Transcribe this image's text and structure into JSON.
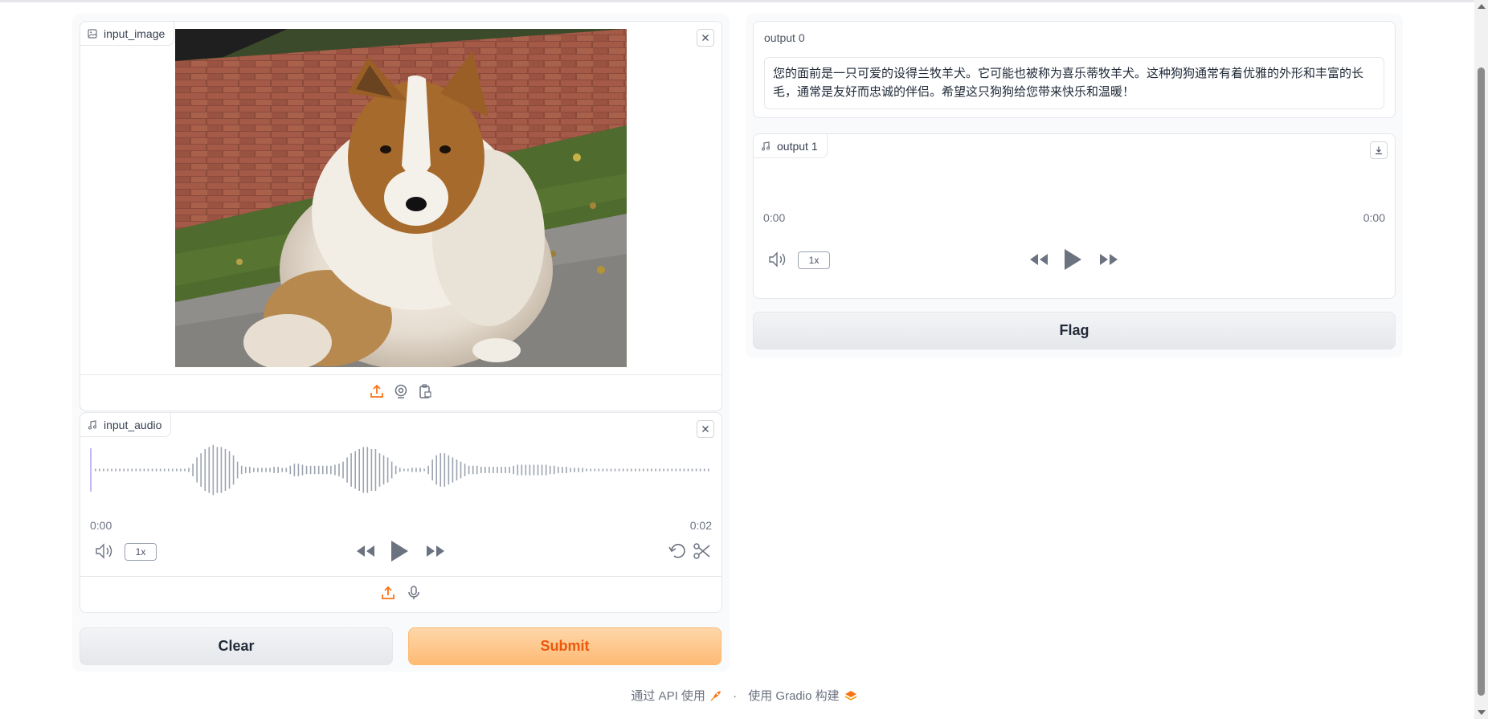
{
  "input_image": {
    "label": "input_image",
    "photo_subject": "Shetland sheepdog sitting on grass and pavement in front of a brick wall"
  },
  "input_audio": {
    "label": "input_audio",
    "time_start": "0:00",
    "time_end": "0:02",
    "speed": "1x",
    "waveform_heights": [
      1,
      1,
      1,
      1,
      1,
      1,
      1,
      1,
      1,
      1,
      1,
      1,
      1,
      1,
      1,
      1,
      1,
      1,
      1,
      1,
      1,
      1,
      1,
      2,
      6,
      12,
      16,
      20,
      22,
      24,
      22,
      22,
      20,
      18,
      14,
      8,
      4,
      3,
      3,
      2,
      2,
      2,
      2,
      2,
      3,
      3,
      2,
      2,
      4,
      6,
      6,
      5,
      4,
      4,
      4,
      4,
      4,
      4,
      4,
      5,
      6,
      8,
      12,
      16,
      18,
      20,
      22,
      22,
      20,
      20,
      16,
      14,
      12,
      8,
      4,
      2,
      1,
      1,
      2,
      2,
      2,
      1,
      4,
      10,
      14,
      16,
      16,
      14,
      12,
      10,
      8,
      6,
      4,
      4,
      4,
      3,
      3,
      3,
      3,
      3,
      3,
      3,
      3,
      4,
      5,
      5,
      5,
      5,
      5,
      5,
      5,
      5,
      4,
      4,
      3,
      3,
      3,
      2,
      2,
      2,
      2,
      1,
      1,
      1,
      1,
      1,
      1,
      1,
      1,
      1,
      1,
      1,
      1,
      1,
      1,
      1,
      1,
      1,
      1,
      1,
      1,
      1,
      1,
      1,
      1,
      1,
      1,
      1,
      1,
      1,
      1,
      1
    ]
  },
  "buttons": {
    "clear": "Clear",
    "submit": "Submit",
    "flag": "Flag"
  },
  "output0": {
    "label": "output 0",
    "text": "您的面前是一只可爱的设得兰牧羊犬。它可能也被称为喜乐蒂牧羊犬。这种狗狗通常有着优雅的外形和丰富的长毛，通常是友好而忠诚的伴侣。希望这只狗狗给您带来快乐和温暖！"
  },
  "output1": {
    "label": "output 1",
    "time_start": "0:00",
    "time_end": "0:00",
    "speed": "1x"
  },
  "footer": {
    "api": "通过 API 使用",
    "separator": "·",
    "built": "使用 Gradio 构建"
  },
  "colors": {
    "accent": "#f97316",
    "submit_bg": "#fdba74"
  }
}
